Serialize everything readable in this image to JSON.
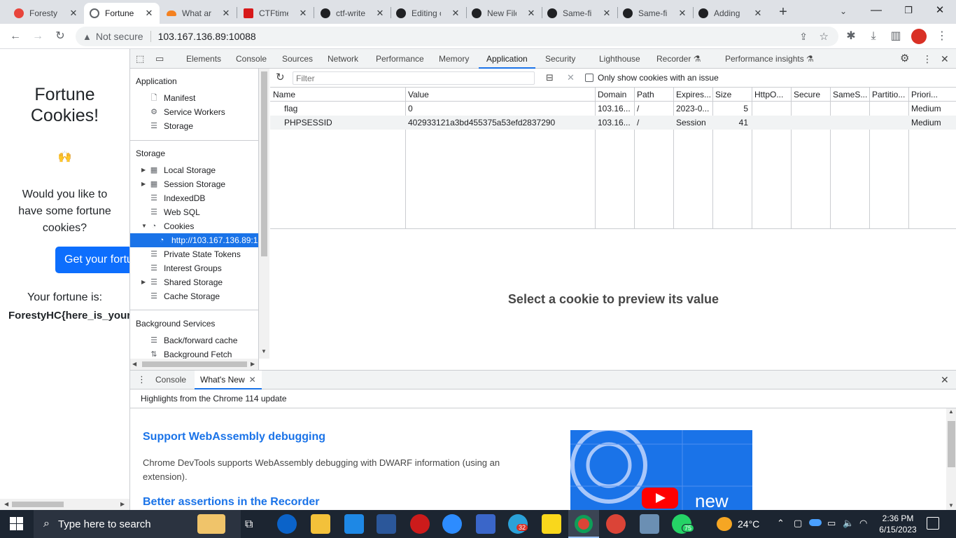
{
  "browser": {
    "tabs": [
      {
        "title": "Foresty",
        "color": "#e8453c"
      },
      {
        "title": "Fortune",
        "color": "#5f6368"
      },
      {
        "title": "What are",
        "color": "#f48120"
      },
      {
        "title": "CTFtime",
        "color": "#d7191a"
      },
      {
        "title": "ctf-write",
        "color": "#202124"
      },
      {
        "title": "Editing c",
        "color": "#202124"
      },
      {
        "title": "New File",
        "color": "#202124"
      },
      {
        "title": "Same-fil",
        "color": "#202124"
      },
      {
        "title": "Same-fil",
        "color": "#202124"
      },
      {
        "title": "Adding",
        "color": "#202124"
      }
    ],
    "security_label": "Not secure",
    "url": "103.167.136.89:10088"
  },
  "page": {
    "title_line1": "Fortune",
    "title_line2": "Cookies!",
    "emoji": "🙌",
    "question_line1": "Would you like to",
    "question_line2": "have some fortune",
    "question_line3": "cookies?",
    "button_label": "Get your fortune",
    "fortune_label": "Your fortune is:",
    "fortune_value": "ForestyHC{here_is_your"
  },
  "devtools": {
    "tabs": [
      "Elements",
      "Console",
      "Sources",
      "Network",
      "Performance",
      "Memory",
      "Application",
      "Security",
      "Lighthouse",
      "Recorder ⚗",
      "Performance insights ⚗"
    ],
    "active_tab": "Application",
    "sidebar": {
      "application_header": "Application",
      "application_items": [
        "Manifest",
        "Service Workers",
        "Storage"
      ],
      "storage_header": "Storage",
      "storage_items": [
        "Local Storage",
        "Session Storage",
        "IndexedDB",
        "Web SQL",
        "Cookies",
        "http://103.167.136.89:1",
        "Private State Tokens",
        "Interest Groups",
        "Shared Storage",
        "Cache Storage"
      ],
      "bg_header": "Background Services",
      "bg_items": [
        "Back/forward cache",
        "Background Fetch"
      ]
    },
    "cookies": {
      "filter_placeholder": "Filter",
      "only_issues_label": "Only show cookies with an issue",
      "columns": [
        "Name",
        "Value",
        "Domain",
        "Path",
        "Expires...",
        "Size",
        "HttpO...",
        "Secure",
        "SameS...",
        "Partitio...",
        "Priori..."
      ],
      "rows": [
        [
          "flag",
          "0",
          "103.16...",
          "/",
          "2023-0...",
          "5",
          "",
          "",
          "",
          "",
          "Medium"
        ],
        [
          "PHPSESSID",
          "402933121a3bd455375a53efd2837290",
          "103.16...",
          "/",
          "Session",
          "41",
          "",
          "",
          "",
          "",
          "Medium"
        ]
      ],
      "preview_text": "Select a cookie to preview its value"
    },
    "drawer": {
      "tabs": [
        "Console",
        "What's New"
      ],
      "active_tab": "What's New",
      "subtitle": "Highlights from the Chrome 114 update",
      "item1_title": "Support WebAssembly debugging",
      "item1_desc_line1": "Chrome DevTools supports WebAssembly debugging with DWARF information (using an",
      "item1_desc_line2": "extension).",
      "item2_title": "Better assertions in the Recorder",
      "video_label": "new"
    }
  },
  "taskbar": {
    "search_placeholder": "Type here to search",
    "badge_count_1": "32",
    "badge_count_2": "75",
    "weather": "24°C",
    "time": "2:36 PM",
    "date": "6/15/2023"
  }
}
